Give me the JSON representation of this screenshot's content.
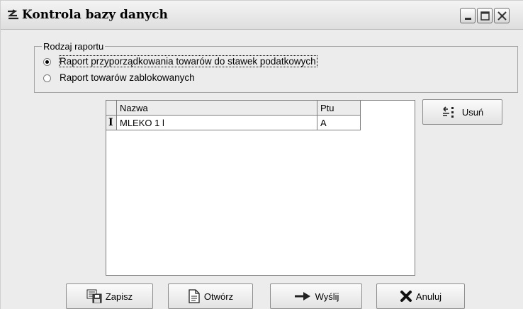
{
  "window": {
    "title": "Kontrola bazy danych"
  },
  "report_group": {
    "legend": "Rodzaj raportu",
    "options": [
      {
        "label": "Raport przyporządkowania towarów do stawek podatkowych",
        "selected": true
      },
      {
        "label": "Raport towarów zablokowanych",
        "selected": false
      }
    ]
  },
  "grid": {
    "columns": [
      "Nazwa",
      "Ptu"
    ],
    "rows": [
      {
        "indicator": "I",
        "nazwa": "MLEKO 1 l",
        "ptu": "A"
      }
    ]
  },
  "buttons": {
    "usun": "Usuń",
    "zapisz": "Zapisz",
    "otworz": "Otwórz",
    "wyslij": "Wyślij",
    "anuluj": "Anuluj"
  },
  "icons": {
    "app": "database-check-icon",
    "delete": "delete-rows-icon",
    "save": "save-icon",
    "open": "open-document-icon",
    "send": "arrow-right-icon",
    "cancel": "x-cancel-icon"
  }
}
